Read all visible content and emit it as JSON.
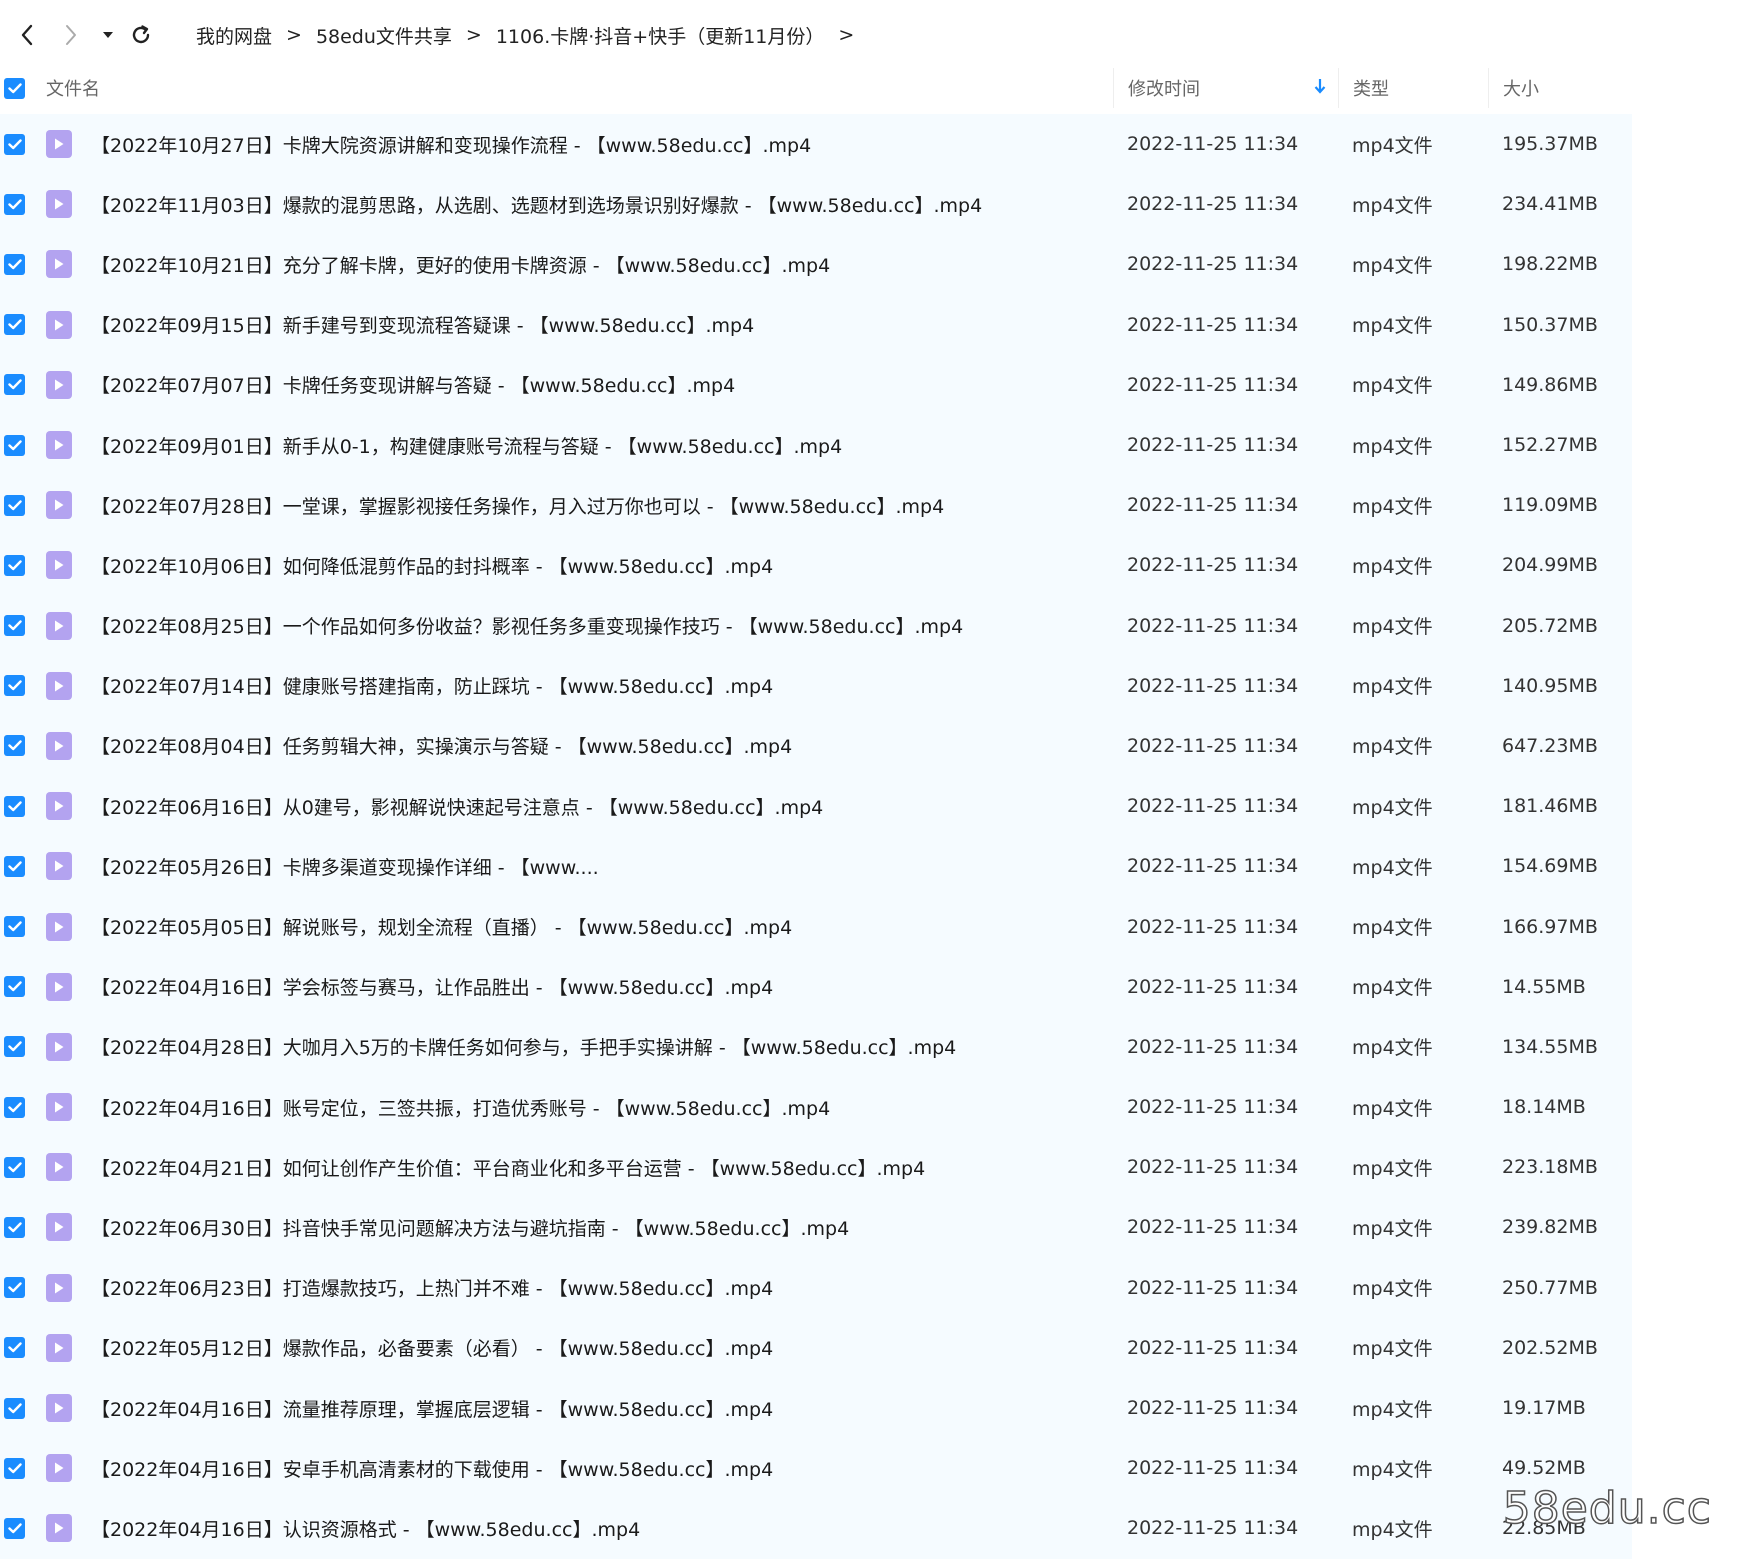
{
  "toolbar": {
    "breadcrumbs": [
      "我的网盘",
      "58edu文件共享",
      "1106.卡牌·抖音+快手（更新11月份）"
    ],
    "separator": ">"
  },
  "columns": {
    "name": "文件名",
    "time": "修改时间",
    "type": "类型",
    "size": "大小"
  },
  "colors": {
    "accent": "#1a8cff",
    "row_bg": "#f5fbff",
    "video_icon": "#b3a3f0"
  },
  "files": [
    {
      "name": "【2022年10月27日】卡牌大院资源讲解和变现操作流程 - 【www.58edu.cc】.mp4",
      "time": "2022-11-25 11:34",
      "type": "mp4文件",
      "size": "195.37MB"
    },
    {
      "name": "【2022年11月03日】爆款的混剪思路，从选剧、选题材到选场景识别好爆款 - 【www.58edu.cc】.mp4",
      "time": "2022-11-25 11:34",
      "type": "mp4文件",
      "size": "234.41MB"
    },
    {
      "name": "【2022年10月21日】充分了解卡牌，更好的使用卡牌资源 - 【www.58edu.cc】.mp4",
      "time": "2022-11-25 11:34",
      "type": "mp4文件",
      "size": "198.22MB"
    },
    {
      "name": "【2022年09月15日】新手建号到变现流程答疑课 - 【www.58edu.cc】.mp4",
      "time": "2022-11-25 11:34",
      "type": "mp4文件",
      "size": "150.37MB"
    },
    {
      "name": "【2022年07月07日】卡牌任务变现讲解与答疑 - 【www.58edu.cc】.mp4",
      "time": "2022-11-25 11:34",
      "type": "mp4文件",
      "size": "149.86MB"
    },
    {
      "name": "【2022年09月01日】新手从0-1，构建健康账号流程与答疑 - 【www.58edu.cc】.mp4",
      "time": "2022-11-25 11:34",
      "type": "mp4文件",
      "size": "152.27MB"
    },
    {
      "name": "【2022年07月28日】一堂课，掌握影视接任务操作，月入过万你也可以 - 【www.58edu.cc】.mp4",
      "time": "2022-11-25 11:34",
      "type": "mp4文件",
      "size": "119.09MB"
    },
    {
      "name": "【2022年10月06日】如何降低混剪作品的封抖概率 - 【www.58edu.cc】.mp4",
      "time": "2022-11-25 11:34",
      "type": "mp4文件",
      "size": "204.99MB"
    },
    {
      "name": "【2022年08月25日】一个作品如何多份收益？影视任务多重变现操作技巧 - 【www.58edu.cc】.mp4",
      "time": "2022-11-25 11:34",
      "type": "mp4文件",
      "size": "205.72MB"
    },
    {
      "name": "【2022年07月14日】健康账号搭建指南，防止踩坑 - 【www.58edu.cc】.mp4",
      "time": "2022-11-25 11:34",
      "type": "mp4文件",
      "size": "140.95MB"
    },
    {
      "name": "【2022年08月04日】任务剪辑大神，实操演示与答疑 - 【www.58edu.cc】.mp4",
      "time": "2022-11-25 11:34",
      "type": "mp4文件",
      "size": "647.23MB"
    },
    {
      "name": "【2022年06月16日】从0建号，影视解说快速起号注意点 - 【www.58edu.cc】.mp4",
      "time": "2022-11-25 11:34",
      "type": "mp4文件",
      "size": "181.46MB"
    },
    {
      "name": "【2022年05月26日】卡牌多渠道变现操作详细 - 【www....",
      "time": "2022-11-25 11:34",
      "type": "mp4文件",
      "size": "154.69MB"
    },
    {
      "name": "【2022年05月05日】解说账号，规划全流程（直播） - 【www.58edu.cc】.mp4",
      "time": "2022-11-25 11:34",
      "type": "mp4文件",
      "size": "166.97MB"
    },
    {
      "name": "【2022年04月16日】学会标签与赛马，让作品胜出 - 【www.58edu.cc】.mp4",
      "time": "2022-11-25 11:34",
      "type": "mp4文件",
      "size": "14.55MB"
    },
    {
      "name": "【2022年04月28日】大咖月入5万的卡牌任务如何参与，手把手实操讲解 - 【www.58edu.cc】.mp4",
      "time": "2022-11-25 11:34",
      "type": "mp4文件",
      "size": "134.55MB"
    },
    {
      "name": "【2022年04月16日】账号定位，三签共振，打造优秀账号 - 【www.58edu.cc】.mp4",
      "time": "2022-11-25 11:34",
      "type": "mp4文件",
      "size": "18.14MB"
    },
    {
      "name": "【2022年04月21日】如何让创作产生价值：平台商业化和多平台运营 - 【www.58edu.cc】.mp4",
      "time": "2022-11-25 11:34",
      "type": "mp4文件",
      "size": "223.18MB"
    },
    {
      "name": "【2022年06月30日】抖音快手常见问题解决方法与避坑指南 - 【www.58edu.cc】.mp4",
      "time": "2022-11-25 11:34",
      "type": "mp4文件",
      "size": "239.82MB"
    },
    {
      "name": "【2022年06月23日】打造爆款技巧，上热门并不难 - 【www.58edu.cc】.mp4",
      "time": "2022-11-25 11:34",
      "type": "mp4文件",
      "size": "250.77MB"
    },
    {
      "name": "【2022年05月12日】爆款作品，必备要素（必看） - 【www.58edu.cc】.mp4",
      "time": "2022-11-25 11:34",
      "type": "mp4文件",
      "size": "202.52MB"
    },
    {
      "name": "【2022年04月16日】流量推荐原理，掌握底层逻辑 - 【www.58edu.cc】.mp4",
      "time": "2022-11-25 11:34",
      "type": "mp4文件",
      "size": "19.17MB"
    },
    {
      "name": "【2022年04月16日】安卓手机高清素材的下载使用 - 【www.58edu.cc】.mp4",
      "time": "2022-11-25 11:34",
      "type": "mp4文件",
      "size": "49.52MB"
    },
    {
      "name": "【2022年04月16日】认识资源格式 - 【www.58edu.cc】.mp4",
      "time": "2022-11-25 11:34",
      "type": "mp4文件",
      "size": "22.85MB"
    }
  ],
  "watermark": "58edu.cc"
}
